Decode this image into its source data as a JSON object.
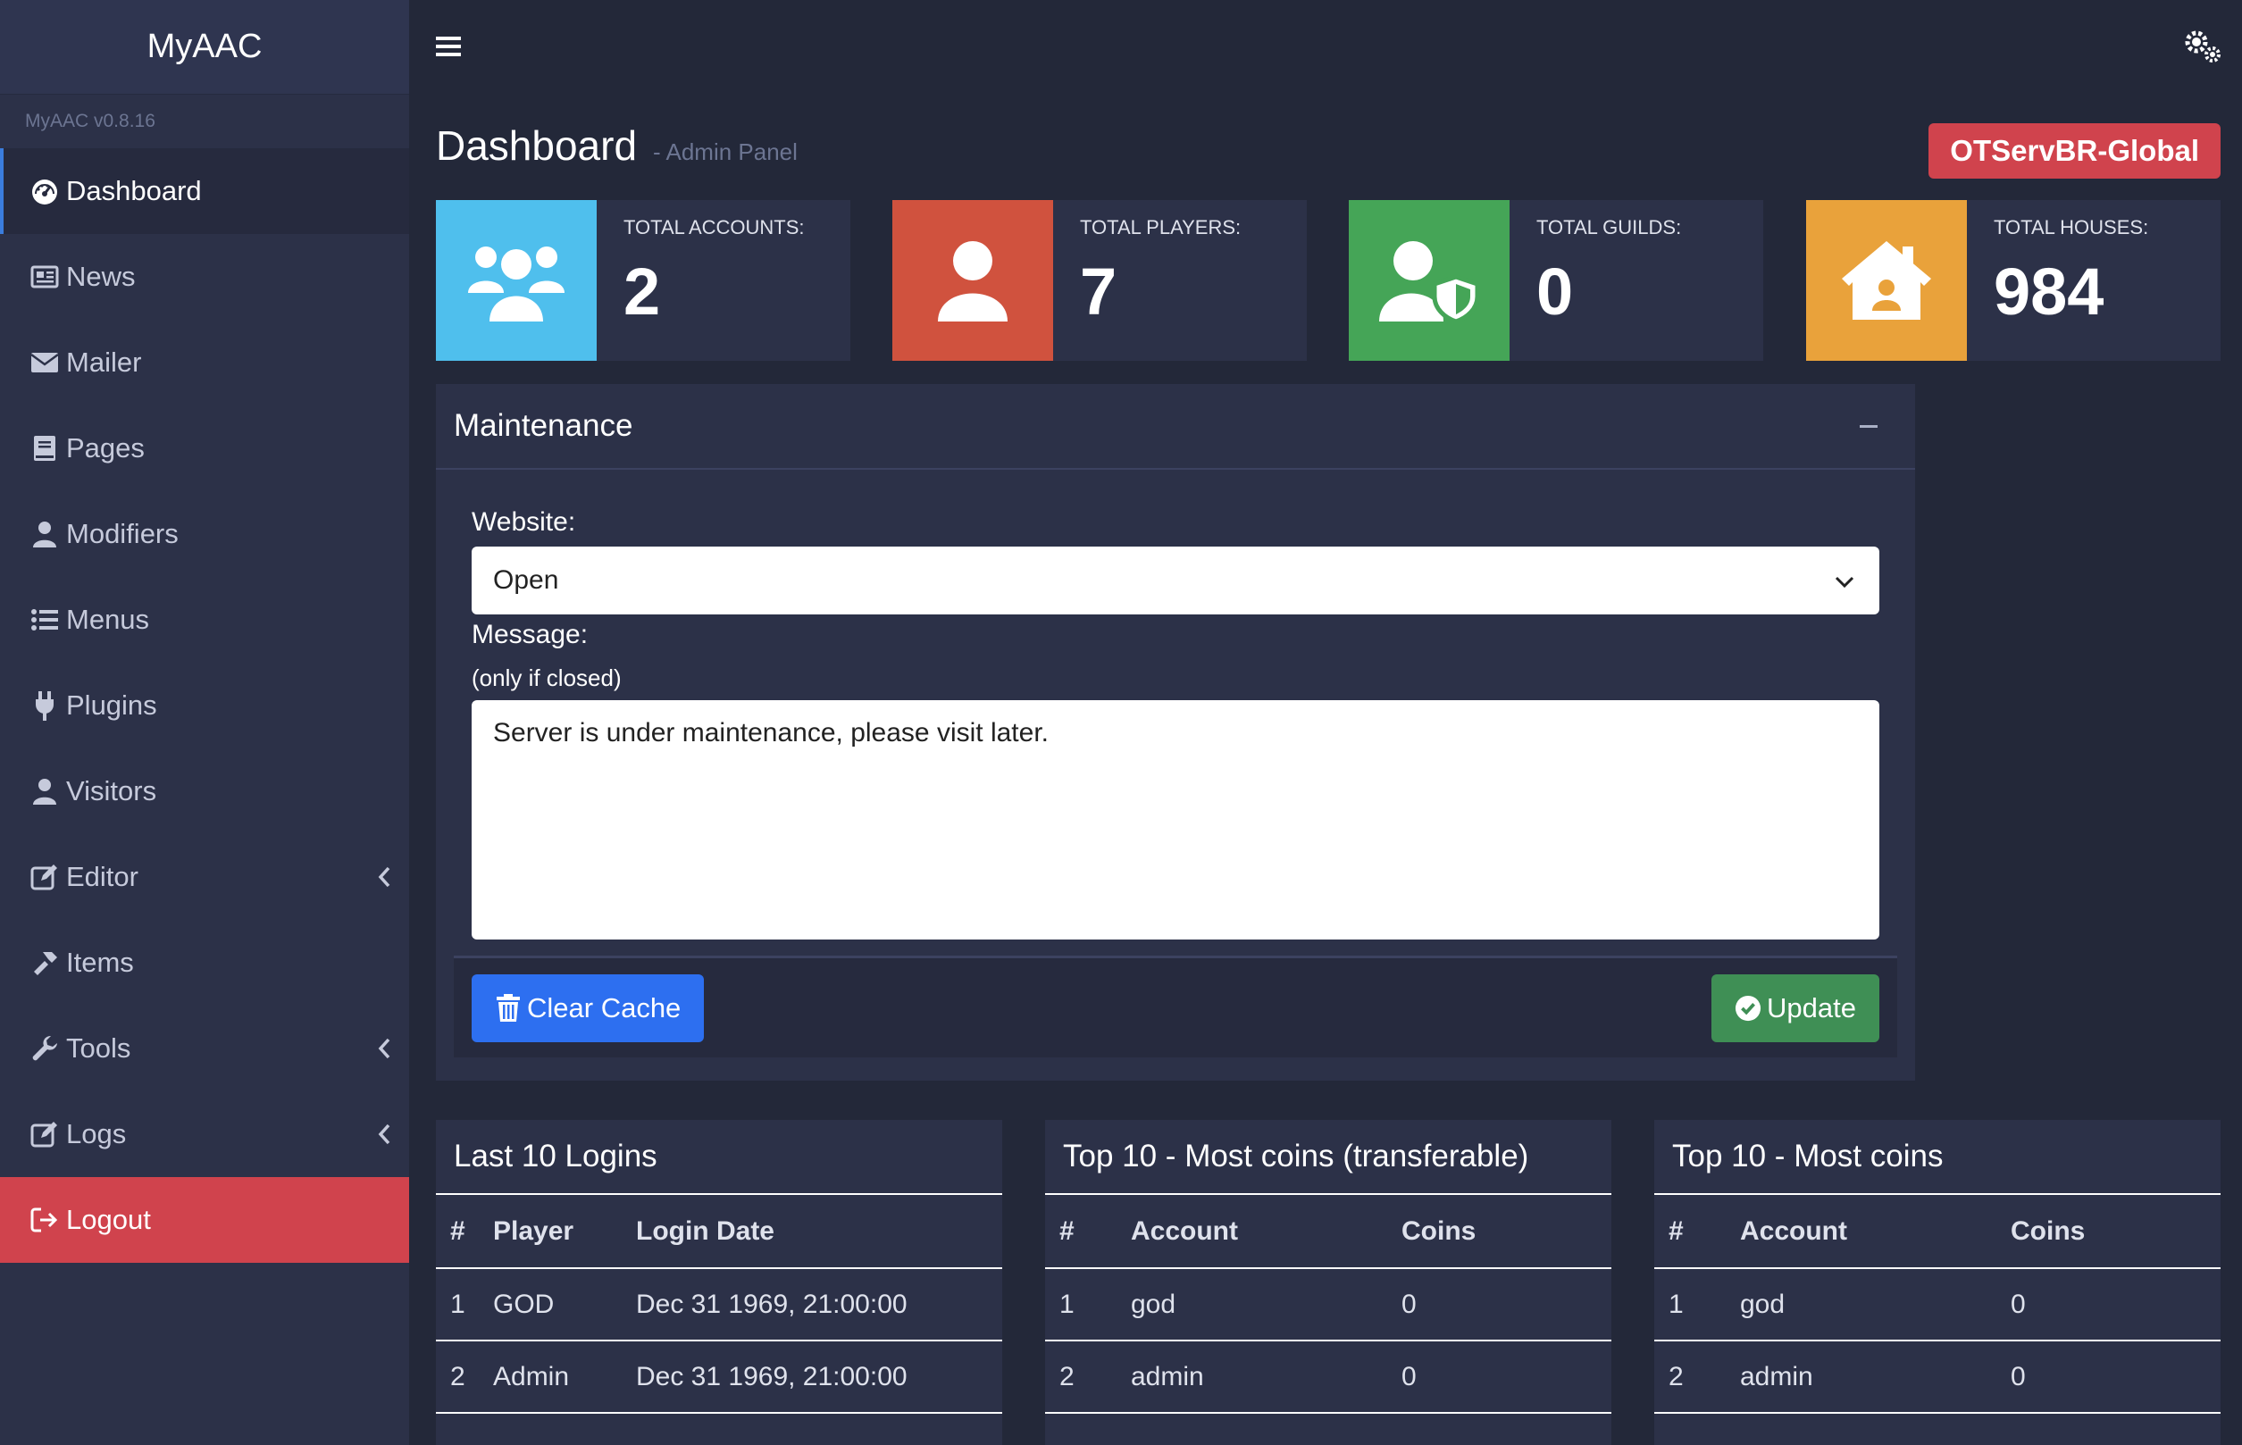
{
  "brand": {
    "title": "MyAAC",
    "version": "MyAAC v0.8.16"
  },
  "sidebar": {
    "items": [
      {
        "label": "Dashboard",
        "icon": "dashboard-icon"
      },
      {
        "label": "News",
        "icon": "newspaper-icon"
      },
      {
        "label": "Mailer",
        "icon": "envelope-icon"
      },
      {
        "label": "Pages",
        "icon": "book-icon"
      },
      {
        "label": "Modifiers",
        "icon": "user-icon"
      },
      {
        "label": "Menus",
        "icon": "list-icon"
      },
      {
        "label": "Plugins",
        "icon": "plug-icon"
      },
      {
        "label": "Visitors",
        "icon": "user-icon"
      },
      {
        "label": "Editor",
        "icon": "edit-icon"
      },
      {
        "label": "Items",
        "icon": "hammer-icon"
      },
      {
        "label": "Tools",
        "icon": "wrench-icon"
      },
      {
        "label": "Logs",
        "icon": "edit-icon"
      },
      {
        "label": "Logout",
        "icon": "sign-out-icon"
      }
    ]
  },
  "header": {
    "title": "Dashboard",
    "subtitle": "- Admin Panel",
    "server": "OTServBR-Global"
  },
  "stats": [
    {
      "label": "TOTAL ACCOUNTS:",
      "value": "2",
      "color": "#4fbfed"
    },
    {
      "label": "TOTAL PLAYERS:",
      "value": "7",
      "color": "#d0523e"
    },
    {
      "label": "TOTAL GUILDS:",
      "value": "0",
      "color": "#45a557"
    },
    {
      "label": "TOTAL HOUSES:",
      "value": "984",
      "color": "#e9a23b"
    }
  ],
  "maintenance": {
    "title": "Maintenance",
    "website_label": "Website:",
    "website_value": "Open",
    "message_label": "Message:",
    "message_hint": "(only if closed)",
    "message_value": "Server is under maintenance, please visit later.",
    "clear_cache": "Clear Cache",
    "update": "Update"
  },
  "logins": {
    "title": "Last 10 Logins",
    "headers": [
      "#",
      "Player",
      "Login Date"
    ],
    "rows": [
      [
        "1",
        "GOD",
        "Dec 31 1969, 21:00:00"
      ],
      [
        "2",
        "Admin",
        "Dec 31 1969, 21:00:00"
      ]
    ]
  },
  "coins_transferable": {
    "title": "Top 10 - Most coins (transferable)",
    "headers": [
      "#",
      "Account",
      "Coins"
    ],
    "rows": [
      [
        "1",
        "god",
        "0"
      ],
      [
        "2",
        "admin",
        "0"
      ]
    ]
  },
  "coins": {
    "title": "Top 10 - Most coins",
    "headers": [
      "#",
      "Account",
      "Coins"
    ],
    "rows": [
      [
        "1",
        "god",
        "0"
      ],
      [
        "2",
        "admin",
        "0"
      ]
    ]
  }
}
